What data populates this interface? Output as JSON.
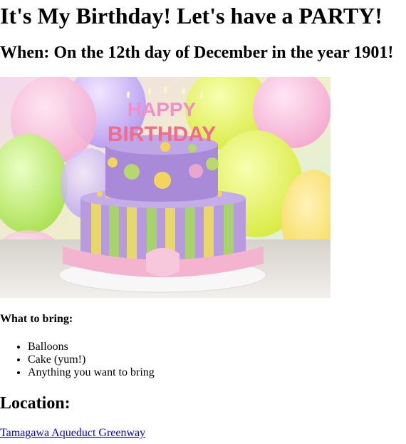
{
  "page": {
    "title": "It's My Birthday! Let's have a PARTY!",
    "when": "When: On the 12th day of December in the year 1901!"
  },
  "image": {
    "description_icon": "birthday-cake-photo",
    "cake_topper_line1": "HAPPY",
    "cake_topper_line2": "BIRTHDAY"
  },
  "bring": {
    "heading": "What to bring:",
    "items": [
      "Balloons",
      "Cake (yum!)",
      "Anything you want to bring"
    ]
  },
  "location": {
    "heading": "Location:",
    "link_text": "Tamagawa Aqueduct Greenway"
  },
  "colors": {
    "link": "#0000ee",
    "text": "#000000",
    "background": "#ffffff"
  }
}
